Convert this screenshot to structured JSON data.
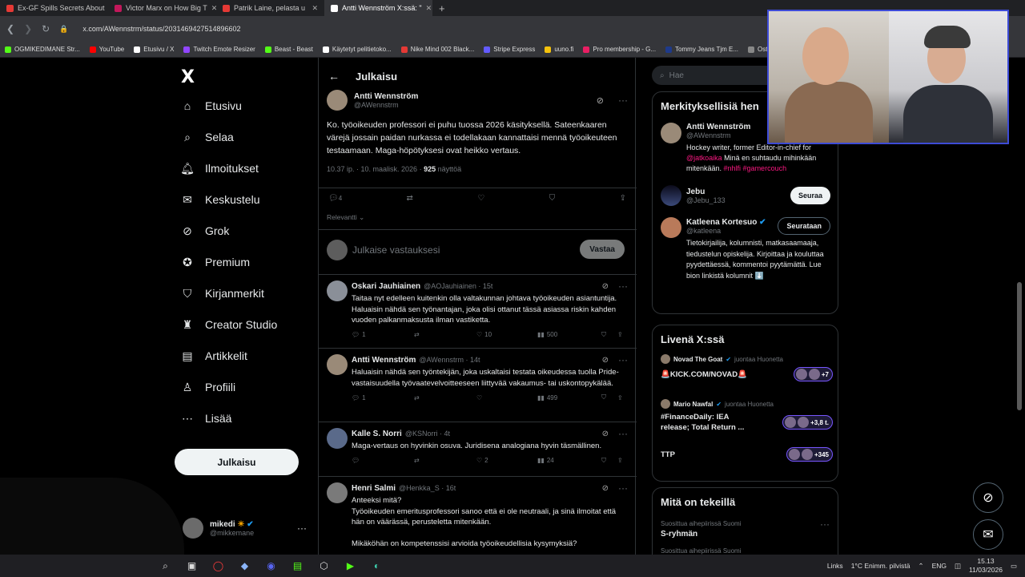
{
  "browser": {
    "tabs": [
      {
        "label": "Ex-GF Spills Secrets About",
        "color": "#e53935"
      },
      {
        "label": "Victor Marx on How Big T",
        "color": "#c2185b"
      },
      {
        "label": "Patrik Laine, pelasta u",
        "color": "#e53935"
      },
      {
        "label": "Antti Wennström X:ssä: \"",
        "color": "#ffffff"
      }
    ],
    "active_tab": 3,
    "url": "x.com/AWennstrm/status/2031469427514896602"
  },
  "bookmarks": [
    {
      "label": "OGMIKEDIMANE Str...",
      "color": "#53fc18"
    },
    {
      "label": "YouTube",
      "color": "#ff0000"
    },
    {
      "label": "Etusivu / X",
      "color": "#ffffff"
    },
    {
      "label": "Twitch Emote Resizer",
      "color": "#9146ff"
    },
    {
      "label": "Beast - Beast",
      "color": "#53fc18"
    },
    {
      "label": "Käytetyt pelitietoko...",
      "color": "#ffffff"
    },
    {
      "label": "Nike Mind 002 Black...",
      "color": "#e53935"
    },
    {
      "label": "Stripe Express",
      "color": "#635bff"
    },
    {
      "label": "uuno.fi",
      "color": "#f4c20d"
    },
    {
      "label": "Pro membership - G...",
      "color": "#e91e63"
    },
    {
      "label": "Tommy Jeans Tjm E...",
      "color": "#1e3a8a"
    },
    {
      "label": "Osta CBD &",
      "color": "#888888"
    }
  ],
  "sidebar": {
    "logo": "X",
    "items": [
      {
        "label": "Etusivu",
        "icon": "home-icon"
      },
      {
        "label": "Selaa",
        "icon": "search-icon"
      },
      {
        "label": "Ilmoitukset",
        "icon": "bell-icon"
      },
      {
        "label": "Keskustelu",
        "icon": "envelope-icon"
      },
      {
        "label": "Grok",
        "icon": "grok-icon"
      },
      {
        "label": "Premium",
        "icon": "premium-icon"
      },
      {
        "label": "Kirjanmerkit",
        "icon": "bookmark-icon"
      },
      {
        "label": "Creator Studio",
        "icon": "creator-icon"
      },
      {
        "label": "Artikkelit",
        "icon": "articles-icon"
      },
      {
        "label": "Profiili",
        "icon": "profile-icon"
      },
      {
        "label": "Lisää",
        "icon": "more-icon"
      }
    ],
    "post_button": "Julkaisu",
    "account": {
      "name": "mikedi",
      "handle": "@mikkemane"
    }
  },
  "main": {
    "header": "Julkaisu",
    "tweet": {
      "name": "Antti Wennström",
      "handle": "@AWennstrm",
      "text": "Ko. työoikeuden professori ei puhu tuossa 2026 käsityksellä. Sateenkaaren värejä jossain paidan nurkassa ei todellakaan kannattaisi mennä työoikeuteen testaamaan. Maga-höpötyksesi ovat heikko vertaus.",
      "time": "10.37 ip. · 10. maalisk. 2026 ·",
      "views": "925",
      "views_label": "näyttöä",
      "replies": "4"
    },
    "sort": "Relevantti",
    "reply_box": {
      "placeholder": "Julkaise vastauksesi",
      "button": "Vastaa"
    },
    "replies": [
      {
        "name": "Oskari Jauhiainen",
        "handle": "@AOJauhiainen · 15t",
        "text": "Taitaa nyt edelleen kuitenkin olla valtakunnan johtava työoikeuden asiantuntija. Haluaisin nähdä sen työnantajan, joka olisi ottanut tässä asiassa riskin kahden vuoden palkanmaksusta ilman vastiketta.",
        "reply": "1",
        "repost": "",
        "like": "10",
        "views": "500"
      },
      {
        "name": "Antti Wennström",
        "handle": "@AWennstrm · 14t",
        "text": "Haluaisin nähdä sen työntekijän, joka uskaltaisi testata oikeudessa tuolla Pride-vastaisuudella työvaatevelvoitteeseen liittyvää vakaumus- tai uskontopykälää.",
        "reply": "1",
        "repost": "",
        "like": "",
        "views": "499"
      },
      {
        "name": "Kalle S. Norri",
        "handle": "@KSNorri · 4t",
        "text": "Maga-vertaus on hyvinkin osuva. Juridisena analogiana hyvin täsmällinen.",
        "reply": "",
        "repost": "",
        "like": "2",
        "views": "24"
      },
      {
        "name": "Henri Salmi",
        "handle": "@Henkka_S · 16t",
        "text": "Anteeksi mitä?\nTyöoikeuden emeritusprofessori sanoo että ei ole neutraali, ja sinä ilmoitat että hän on väärässä, perusteletta mitenkään.\n\nMikäköhän on kompetenssisi arvioida työoikeudellisia kysymyksiä?",
        "reply": "",
        "repost": "",
        "like": "",
        "views": ""
      }
    ]
  },
  "right": {
    "search_placeholder": "Hae",
    "relevant": {
      "title": "Merkityksellisiä hen",
      "people": [
        {
          "name": "Antti Wennström",
          "handle": "@AWennstrm",
          "bio_pre": "Hockey writer, former Editor-in-chief for ",
          "bio_link": "@jatkoaika",
          "bio_mid": " Minä en suhtaudu mihinkään mitenkään. ",
          "bio_tags": "#nhlfi #gamercouch"
        },
        {
          "name": "Jebu",
          "handle": "@Jebu_133",
          "button": "Seuraa"
        },
        {
          "name": "Katleena Kortesuo",
          "handle": "@katleena",
          "button": "Seurataan",
          "bio": "Tietokirjailija, kolumnisti, matkasaamaaja, tiedustelun opiskelija. Kirjoittaa ja kouluttaa pyydettäessä, kommentoi pyytämättä. Lue bion linkistä kolumnit ⬇️"
        }
      ]
    },
    "live": {
      "title": "Livenä X:ssä",
      "items": [
        {
          "host": "Novad The Goat",
          "suffix": "juontaa Huonetta",
          "text": "🚨KICK.COM/NOVAD🚨",
          "count": "+7"
        },
        {
          "host": "Mario Nawfal",
          "suffix": "juontaa Huonetta",
          "text": "#FinanceDaily: IEA release; Total Return ...",
          "count": "+3,8 t."
        },
        {
          "host": "",
          "suffix": "",
          "text": "TTP",
          "count": "+345"
        }
      ]
    },
    "happening": {
      "title": "Mitä on tekeillä",
      "sub": "Suosittua aihepiirissä Suomi",
      "topic": "S-ryhmän",
      "sub2": "Suosittua aihepiirissä Suomi"
    }
  },
  "taskbar": {
    "links": "Links",
    "weather": "1°C  Enimm. pilvistä",
    "lang": "ENG",
    "time": "15.13",
    "date": "11/03/2026"
  }
}
